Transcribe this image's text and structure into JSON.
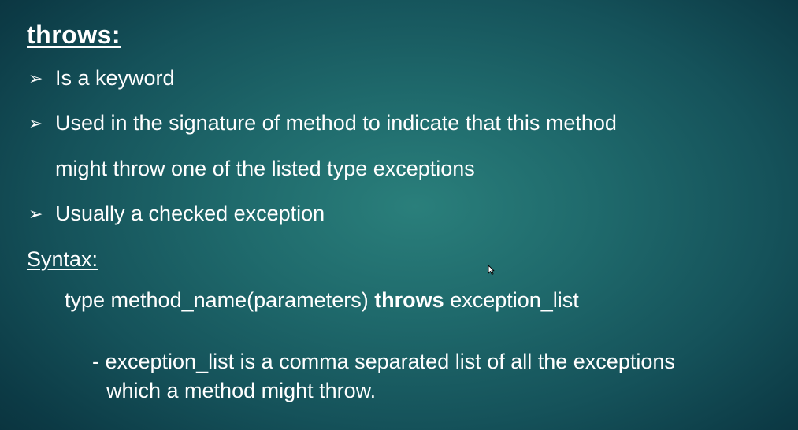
{
  "slide": {
    "title": "throws:",
    "bullet_marker": "➢",
    "bullets": [
      {
        "text": "Is a keyword"
      },
      {
        "text": "Used in the signature of method to indicate that this method",
        "continuation": "might throw one of the listed type exceptions"
      },
      {
        "text": "Usually a checked exception"
      }
    ],
    "syntax": {
      "label": "Syntax:",
      "prefix": "type method_name(parameters) ",
      "keyword": "throws",
      "suffix": " exception_list"
    },
    "note": {
      "line1": "- exception_list is a comma separated list of all the exceptions",
      "line2": "which a method might throw."
    },
    "colors": {
      "text": "#ffffff",
      "background_center": "#2a7f7b",
      "background_edge": "#092f3a"
    },
    "icons": {
      "cursor": "mouse-pointer-icon"
    }
  }
}
